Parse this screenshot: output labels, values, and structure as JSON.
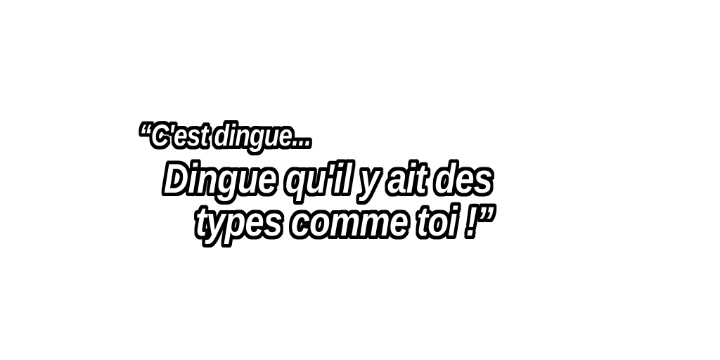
{
  "quote": {
    "line1": "“C'est dingue...",
    "line2": "Dingue qu'il y ait des",
    "line3": "types comme toi !”"
  },
  "colors": {
    "background": "#ffffff",
    "text_fill": "#ffffff",
    "text_outline": "#000000"
  }
}
